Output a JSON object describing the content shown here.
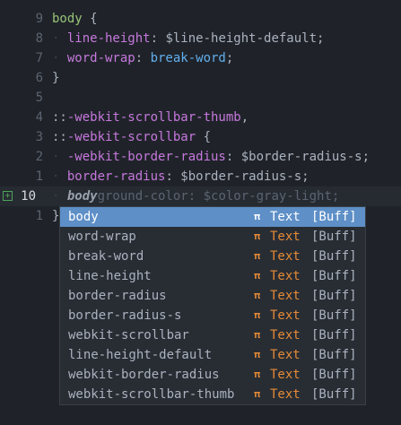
{
  "lines": [
    {
      "num": "9",
      "indent": "",
      "parts": [
        {
          "t": "body",
          "c": "sel"
        },
        {
          "t": " {",
          "c": "punct"
        }
      ]
    },
    {
      "num": "8",
      "indent": "· ",
      "parts": [
        {
          "t": "line-height",
          "c": "prop"
        },
        {
          "t": ": ",
          "c": "punct"
        },
        {
          "t": "$line-height-default",
          "c": "var"
        },
        {
          "t": ";",
          "c": "punct"
        }
      ]
    },
    {
      "num": "7",
      "indent": "· ",
      "parts": [
        {
          "t": "word-wrap",
          "c": "prop"
        },
        {
          "t": ": ",
          "c": "punct"
        },
        {
          "t": "break-word",
          "c": "val"
        },
        {
          "t": ";",
          "c": "punct"
        }
      ]
    },
    {
      "num": "6",
      "indent": "",
      "parts": [
        {
          "t": "}",
          "c": "punct"
        }
      ]
    },
    {
      "num": "5",
      "indent": "",
      "parts": []
    },
    {
      "num": "4",
      "indent": "",
      "parts": [
        {
          "t": "::",
          "c": "punct"
        },
        {
          "t": "-webkit-scrollbar-thumb",
          "c": "pseudo"
        },
        {
          "t": ",",
          "c": "punct"
        }
      ]
    },
    {
      "num": "3",
      "indent": "",
      "parts": [
        {
          "t": "::",
          "c": "punct"
        },
        {
          "t": "-webkit-scrollbar",
          "c": "pseudo"
        },
        {
          "t": " {",
          "c": "punct"
        }
      ]
    },
    {
      "num": "2",
      "indent": "· ",
      "parts": [
        {
          "t": "-webkit-border-radius",
          "c": "prop"
        },
        {
          "t": ": ",
          "c": "punct"
        },
        {
          "t": "$border-radius-s",
          "c": "var"
        },
        {
          "t": ";",
          "c": "punct"
        }
      ]
    },
    {
      "num": "1",
      "indent": "· ",
      "parts": [
        {
          "t": "border-radius",
          "c": "prop"
        },
        {
          "t": ": ",
          "c": "punct"
        },
        {
          "t": "$border-radius-s",
          "c": "var"
        },
        {
          "t": ";",
          "c": "punct"
        }
      ]
    },
    {
      "num": "10",
      "indent": "· ",
      "current": true,
      "parts": [
        {
          "t": "body",
          "c": "typed"
        },
        {
          "t": "ground-color: $color-gray-light;",
          "c": "ghost"
        }
      ]
    },
    {
      "num": "1",
      "indent": "",
      "parts": [
        {
          "t": "}",
          "c": "punct"
        }
      ]
    }
  ],
  "gutter_sign": "+",
  "completion": {
    "items": [
      {
        "label": "body",
        "icon": "𝛑",
        "kind": "Text",
        "source": "[Buff]",
        "selected": true
      },
      {
        "label": "word-wrap",
        "icon": "𝛑",
        "kind": "Text",
        "source": "[Buff]"
      },
      {
        "label": "break-word",
        "icon": "𝛑",
        "kind": "Text",
        "source": "[Buff]"
      },
      {
        "label": "line-height",
        "icon": "𝛑",
        "kind": "Text",
        "source": "[Buff]"
      },
      {
        "label": "border-radius",
        "icon": "𝛑",
        "kind": "Text",
        "source": "[Buff]"
      },
      {
        "label": "border-radius-s",
        "icon": "𝛑",
        "kind": "Text",
        "source": "[Buff]"
      },
      {
        "label": "webkit-scrollbar",
        "icon": "𝛑",
        "kind": "Text",
        "source": "[Buff]"
      },
      {
        "label": "line-height-default",
        "icon": "𝛑",
        "kind": "Text",
        "source": "[Buff]"
      },
      {
        "label": "webkit-border-radius",
        "icon": "𝛑",
        "kind": "Text",
        "source": "[Buff]"
      },
      {
        "label": "webkit-scrollbar-thumb",
        "icon": "𝛑",
        "kind": "Text",
        "source": "[Buff]"
      }
    ]
  },
  "colors": {
    "background": "#1f2329",
    "selected_item": "#5e8fc7",
    "kind_text": "#e58a36",
    "git_added": "#4fa35a"
  }
}
